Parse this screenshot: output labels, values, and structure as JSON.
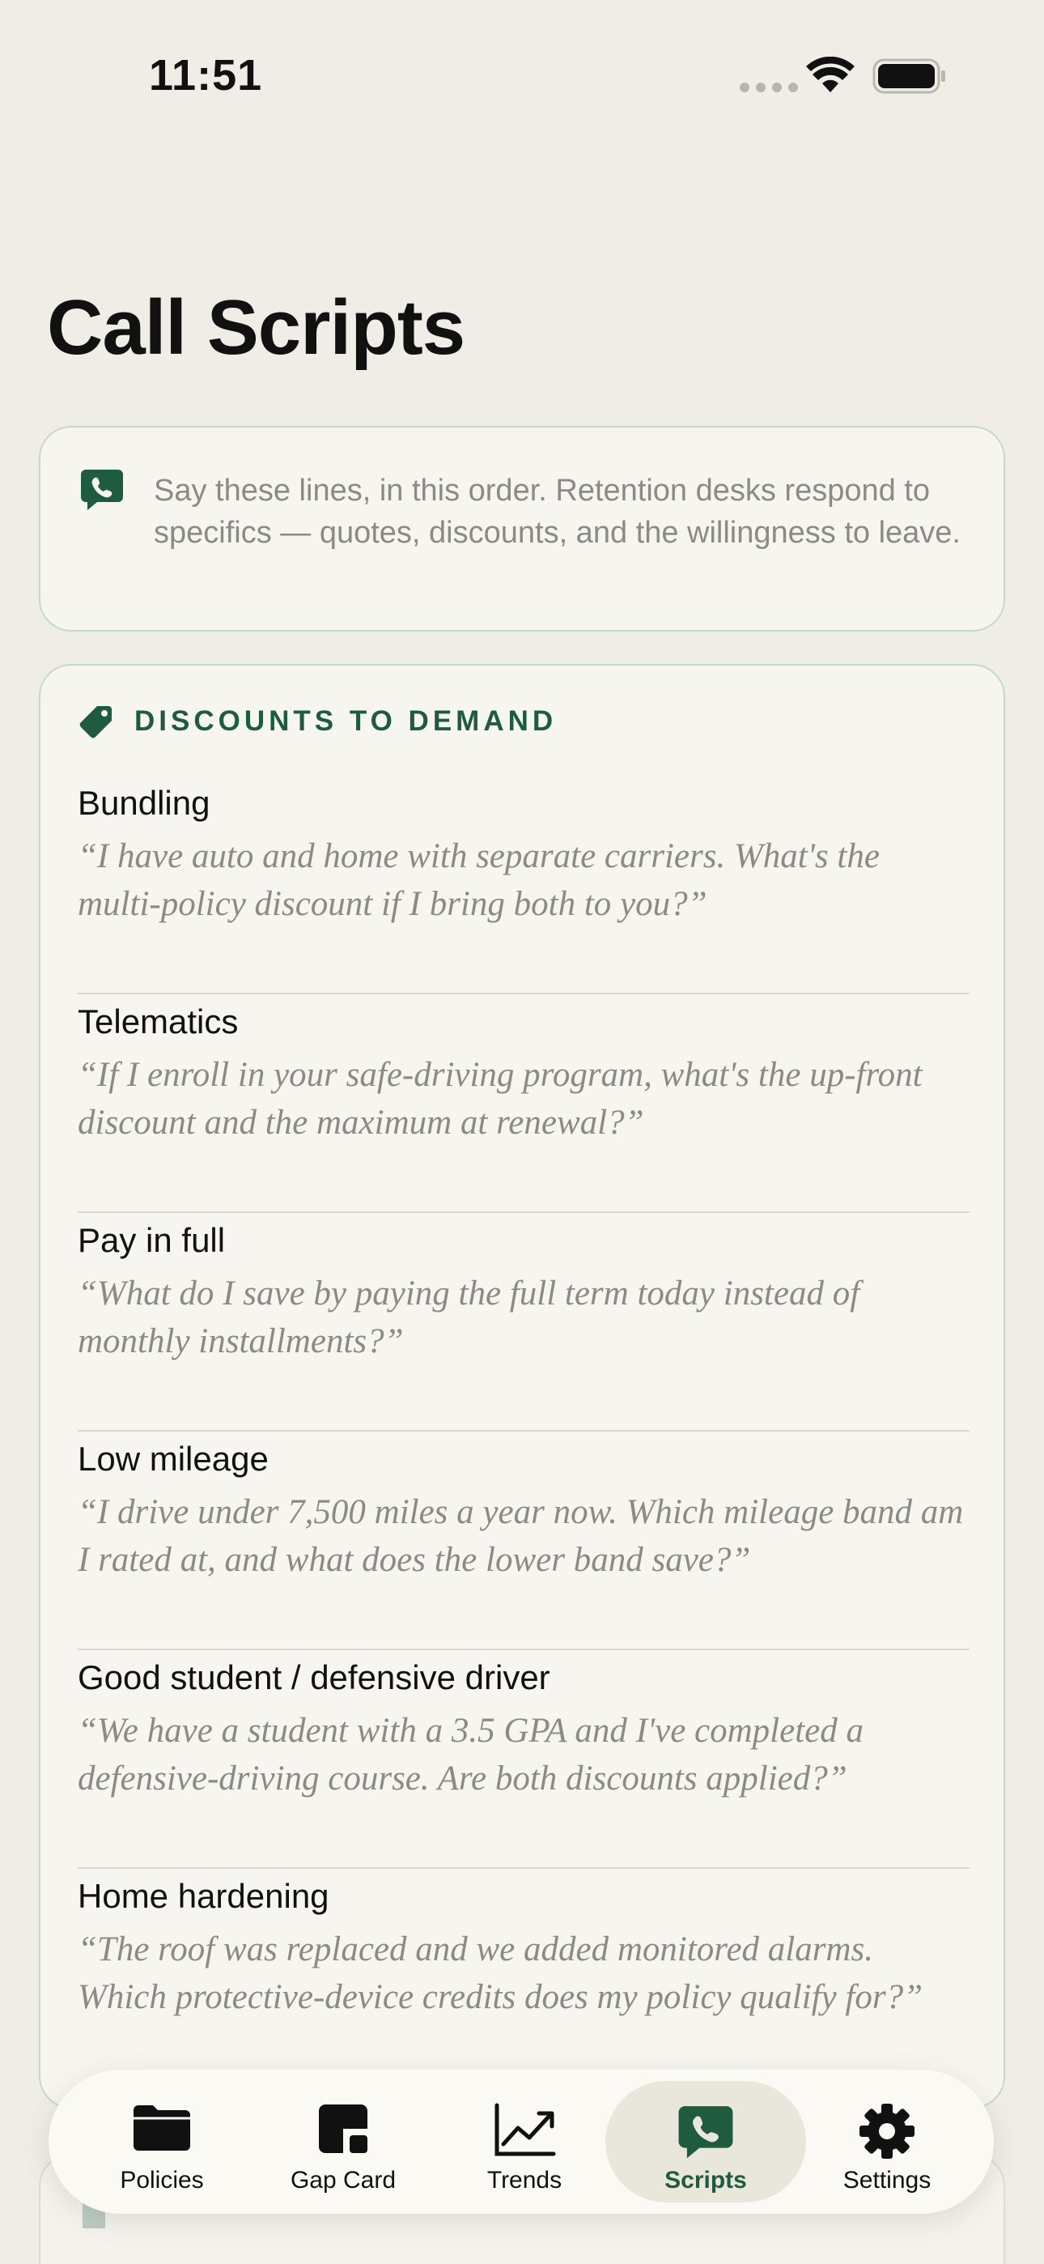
{
  "status_bar": {
    "time": "11:51"
  },
  "page": {
    "title": "Call Scripts"
  },
  "intro": {
    "text": "Say these lines, in this order. Retention desks respond to specifics — quotes, discounts, and the willingness to leave."
  },
  "discounts": {
    "title": "DISCOUNTS TO DEMAND",
    "items": [
      {
        "name": "Bundling",
        "quote": "“I have auto and home with separate carriers. What's the multi-policy discount if I bring both to you?”"
      },
      {
        "name": "Telematics",
        "quote": "“If I enroll in your safe-driving program, what's the up-front discount and the maximum at renewal?”"
      },
      {
        "name": "Pay in full",
        "quote": "“What do I save by paying the full term today instead of monthly installments?”"
      },
      {
        "name": "Low mileage",
        "quote": "“I drive under 7,500 miles a year now. Which mileage band am I rated at, and what does the lower band save?”"
      },
      {
        "name": "Good student / defensive driver",
        "quote": "“We have a student with a 3.5 GPA and I've completed a defensive-driving course. Are both discounts applied?”"
      },
      {
        "name": "Home hardening",
        "quote": "“The roof was replaced and we added monitored alarms. Which protective-device credits does my policy qualify for?”"
      }
    ]
  },
  "tab_bar": {
    "tabs": [
      {
        "label": "Policies",
        "icon": "folder-icon",
        "active": false
      },
      {
        "label": "Gap Card",
        "icon": "gap-card-icon",
        "active": false
      },
      {
        "label": "Trends",
        "icon": "chart-line-icon",
        "active": false
      },
      {
        "label": "Scripts",
        "icon": "phone-bubble-icon",
        "active": true
      },
      {
        "label": "Settings",
        "icon": "gear-icon",
        "active": false
      }
    ]
  },
  "colors": {
    "accent": "#1f5c3f",
    "background": "#efede6",
    "card": "#f6f5f0",
    "muted_text": "#8b8a85"
  }
}
